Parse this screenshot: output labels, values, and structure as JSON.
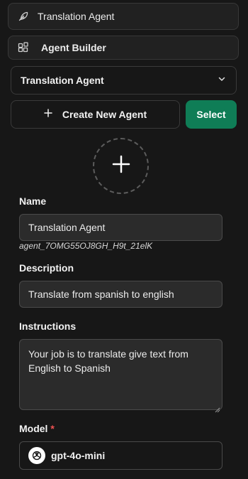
{
  "nav": {
    "item1_label": "Translation Agent",
    "item2_label": "Agent Builder"
  },
  "agent_select": {
    "selected": "Translation Agent"
  },
  "actions": {
    "create_label": "Create New Agent",
    "select_label": "Select"
  },
  "form": {
    "name_label": "Name",
    "name_value": "Translation Agent",
    "agent_id": "agent_7OMG55OJ8GH_H9t_21elK",
    "description_label": "Description",
    "description_value": "Translate from spanish to english",
    "instructions_label": "Instructions",
    "instructions_value": "Your job is to translate give text from English to Spanish",
    "model_label": "Model",
    "model_required_mark": "*",
    "model_value": "gpt-4o-mini"
  },
  "colors": {
    "background": "#171717",
    "accent_green": "#0f7d56",
    "required_red": "#f05252"
  },
  "icons": {
    "nav1": "feather-icon",
    "nav2": "blocks-icon",
    "dropdown": "chevron-down-icon",
    "create": "plus-icon",
    "avatar": "plus-icon",
    "model": "openai-logo-icon"
  }
}
